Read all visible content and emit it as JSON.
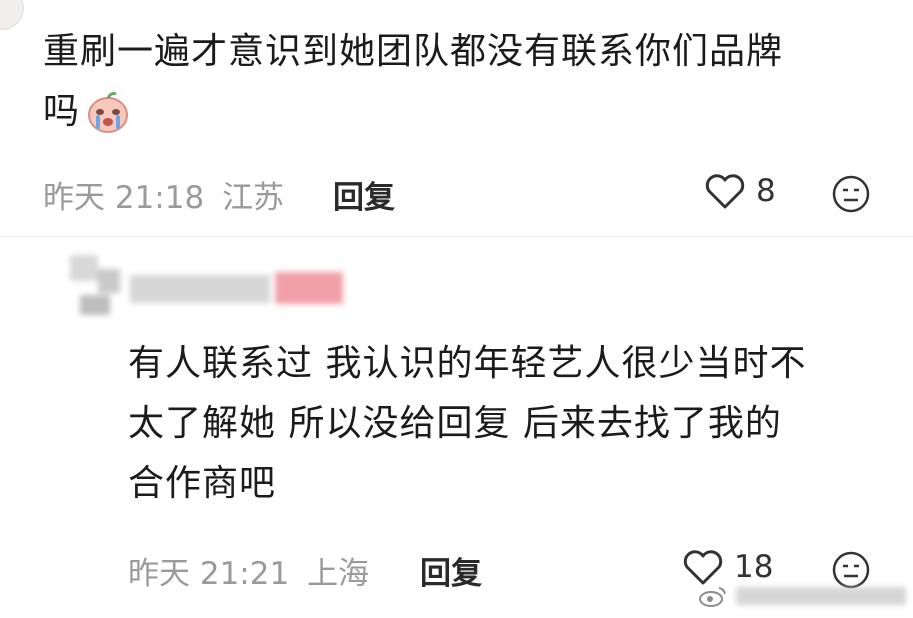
{
  "comment1": {
    "text_line1": "重刷一遍才意识到她团队都没有联系你们品牌",
    "text_line2": "吗",
    "emoji": "crying-face-emoji",
    "time": "昨天 21:18",
    "location": "江苏",
    "reply_label": "回复",
    "likes": "8"
  },
  "comment2": {
    "text_line1": "有人联系过 我认识的年轻艺人很少当时不",
    "text_line2": "太了解她 所以没给回复 后来去找了我的",
    "text_line3": "合作商吧",
    "time": "昨天 21:21",
    "location": "上海",
    "reply_label": "回复",
    "likes": "18"
  },
  "colors": {
    "meta_gray": "#9a9a9a",
    "text": "#1b1b1b",
    "blur_pink": "#f2a0a8"
  },
  "icons": [
    "heart-icon",
    "emoji-face-icon",
    "weibo-logo-icon"
  ]
}
